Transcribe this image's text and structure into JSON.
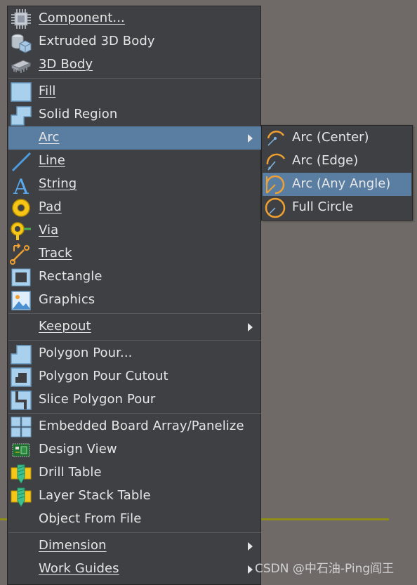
{
  "colors": {
    "background": "#6f6a67",
    "menu_bg": "#3f4043",
    "highlight": "#5a7ea2",
    "accent_orange": "#f0a030",
    "guide_line": "#8f8f18"
  },
  "menu": {
    "items": [
      {
        "label": "Component...",
        "icon": "component-chip-icon"
      },
      {
        "label": "Extruded 3D Body",
        "icon": "extruded-body-icon"
      },
      {
        "label": "3D Body",
        "icon": "3d-body-icon"
      },
      {
        "label": "Fill",
        "icon": "fill-icon"
      },
      {
        "label": "Solid Region",
        "icon": "solid-region-icon"
      },
      {
        "label": "Arc",
        "icon": "",
        "submenu": true,
        "selected": true
      },
      {
        "label": "Line",
        "icon": "line-icon"
      },
      {
        "label": "String",
        "icon": "string-icon"
      },
      {
        "label": "Pad",
        "icon": "pad-icon"
      },
      {
        "label": "Via",
        "icon": "via-icon"
      },
      {
        "label": "Track",
        "icon": "track-icon"
      },
      {
        "label": "Rectangle",
        "icon": "rectangle-icon"
      },
      {
        "label": "Graphics",
        "icon": "graphics-icon"
      },
      {
        "label": "Keepout",
        "icon": "",
        "submenu": true
      },
      {
        "label": "Polygon Pour...",
        "icon": "polygon-pour-icon"
      },
      {
        "label": "Polygon Pour Cutout",
        "icon": "polygon-cutout-icon"
      },
      {
        "label": "Slice Polygon Pour",
        "icon": "slice-polygon-icon"
      },
      {
        "label": "Embedded Board Array/Panelize",
        "icon": "board-array-icon"
      },
      {
        "label": "Design View",
        "icon": "design-view-icon"
      },
      {
        "label": "Drill Table",
        "icon": "drill-table-icon"
      },
      {
        "label": "Layer Stack Table",
        "icon": "layer-stack-table-icon"
      },
      {
        "label": "Object From File",
        "icon": ""
      },
      {
        "label": "Dimension",
        "icon": "",
        "submenu": true
      },
      {
        "label": "Work Guides",
        "icon": "",
        "submenu": true
      }
    ]
  },
  "arc_submenu": {
    "items": [
      {
        "label": "Arc (Center)",
        "icon": "arc-center-icon"
      },
      {
        "label": "Arc (Edge)",
        "icon": "arc-edge-icon"
      },
      {
        "label": "Arc (Any Angle)",
        "icon": "arc-any-angle-icon",
        "selected": true
      },
      {
        "label": "Full Circle",
        "icon": "full-circle-icon"
      }
    ]
  },
  "watermark": "CSDN @中石油-Ping阎王"
}
